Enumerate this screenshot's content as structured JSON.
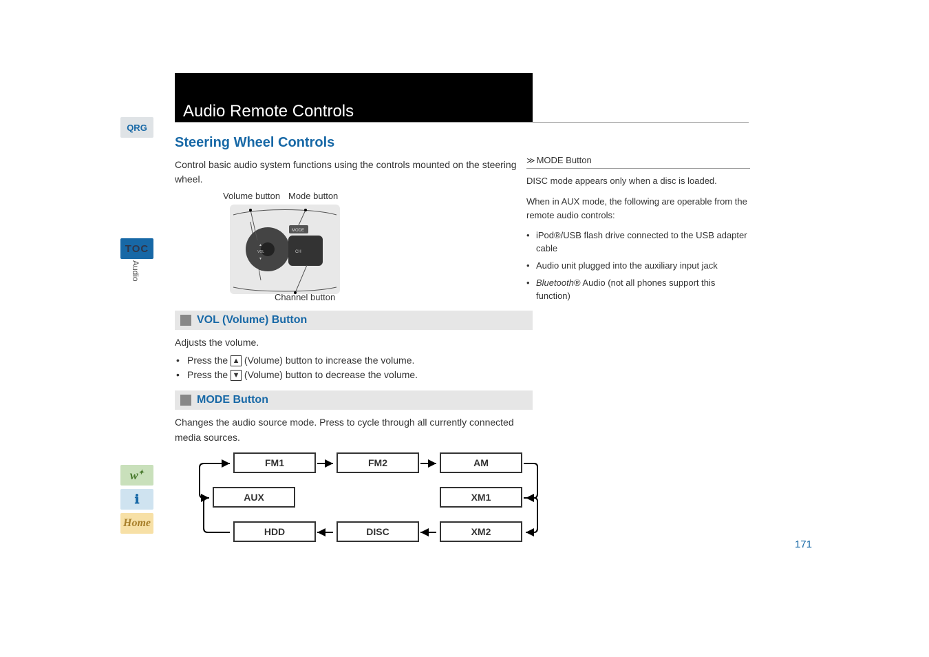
{
  "page_number": "171",
  "sidebar": {
    "qrg": "QRG",
    "toc": "TOC",
    "audio": "Audio",
    "voice_name": "voice-icon",
    "info_name": "info-icon",
    "home_name": "home-icon"
  },
  "title": "Audio Remote Controls",
  "section_title": "Steering Wheel Controls",
  "intro": "Control basic audio system functions using the controls mounted on the steering wheel.",
  "diagram": {
    "volume_label": "Volume button",
    "mode_label": "Mode button",
    "channel_label": "Channel button",
    "btn_mode": "MODE",
    "btn_vol": "VOL",
    "btn_ch": "CH"
  },
  "sections": [
    {
      "heading": "VOL (Volume) Button",
      "body": "Adjusts the volume.",
      "bullets": [
        {
          "pre": "Press the ",
          "sym": "▲",
          "post": " (Volume) button to increase the volume."
        },
        {
          "pre": "Press the ",
          "sym": "▼",
          "post": " (Volume) button to decrease the volume."
        }
      ]
    },
    {
      "heading": "MODE Button",
      "body": "Changes the audio source mode. Press to cycle through all currently connected media sources.",
      "flow": [
        "FM1",
        "FM2",
        "AM",
        "XM1",
        "XM2",
        "DISC",
        "HDD",
        "AUX"
      ]
    }
  ],
  "right": {
    "title": "MODE Button",
    "para1": "DISC mode appears only when a disc is loaded.",
    "para2": "When in AUX mode, the following are operable from the remote audio controls:",
    "bullets": [
      "iPod®/USB flash drive connected to the USB adapter cable",
      "Audio unit plugged into the auxiliary input jack",
      "Bluetooth® Audio (not all phones support this function)"
    ]
  }
}
